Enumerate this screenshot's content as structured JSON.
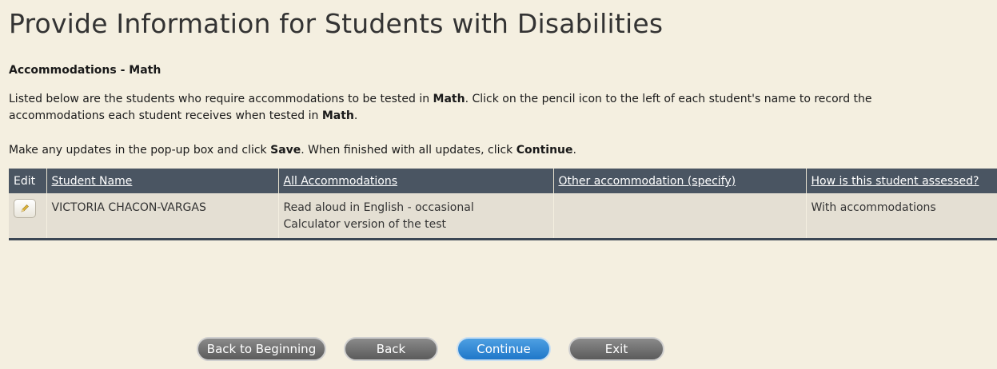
{
  "page": {
    "title": "Provide Information for Students with Disabilities",
    "subhead": "Accommodations - Math",
    "para1": [
      {
        "t": "Listed below are the students who require accommodations to be tested in ",
        "b": false
      },
      {
        "t": "Math",
        "b": true
      },
      {
        "t": ". Click on the pencil icon to the left of each student's name to record the accommodations each student receives when tested in ",
        "b": false
      },
      {
        "t": "Math",
        "b": true
      },
      {
        "t": ".",
        "b": false
      }
    ],
    "para2": [
      {
        "t": "Make any updates in the pop-up box and click ",
        "b": false
      },
      {
        "t": "Save",
        "b": true
      },
      {
        "t": ". When finished with all updates, click ",
        "b": false
      },
      {
        "t": "Continue",
        "b": true
      },
      {
        "t": ".",
        "b": false
      }
    ]
  },
  "table": {
    "headers": {
      "edit": "Edit",
      "student_name": "Student Name",
      "all_accommodations": "All Accommodations",
      "other_accommodation": "Other accommodation (specify)",
      "assessed": "How is this student assessed?"
    },
    "rows": [
      {
        "student_name": "VICTORIA CHACON-VARGAS",
        "accommodation_1": "Read aloud in English - occasional",
        "accommodation_2": "Calculator version of the test",
        "other": "",
        "assessed": "With accommodations",
        "edit_icon": "pencil-icon"
      }
    ]
  },
  "buttons": {
    "back_to_beginning": "Back to Beginning",
    "back": "Back",
    "continue": "Continue",
    "exit": "Exit"
  },
  "colors": {
    "background": "#f4efe0",
    "table_header": "#4a5562",
    "row": "#e4dfd3",
    "primary_button": "#1f77c9",
    "secondary_button": "#6b6b6b"
  }
}
